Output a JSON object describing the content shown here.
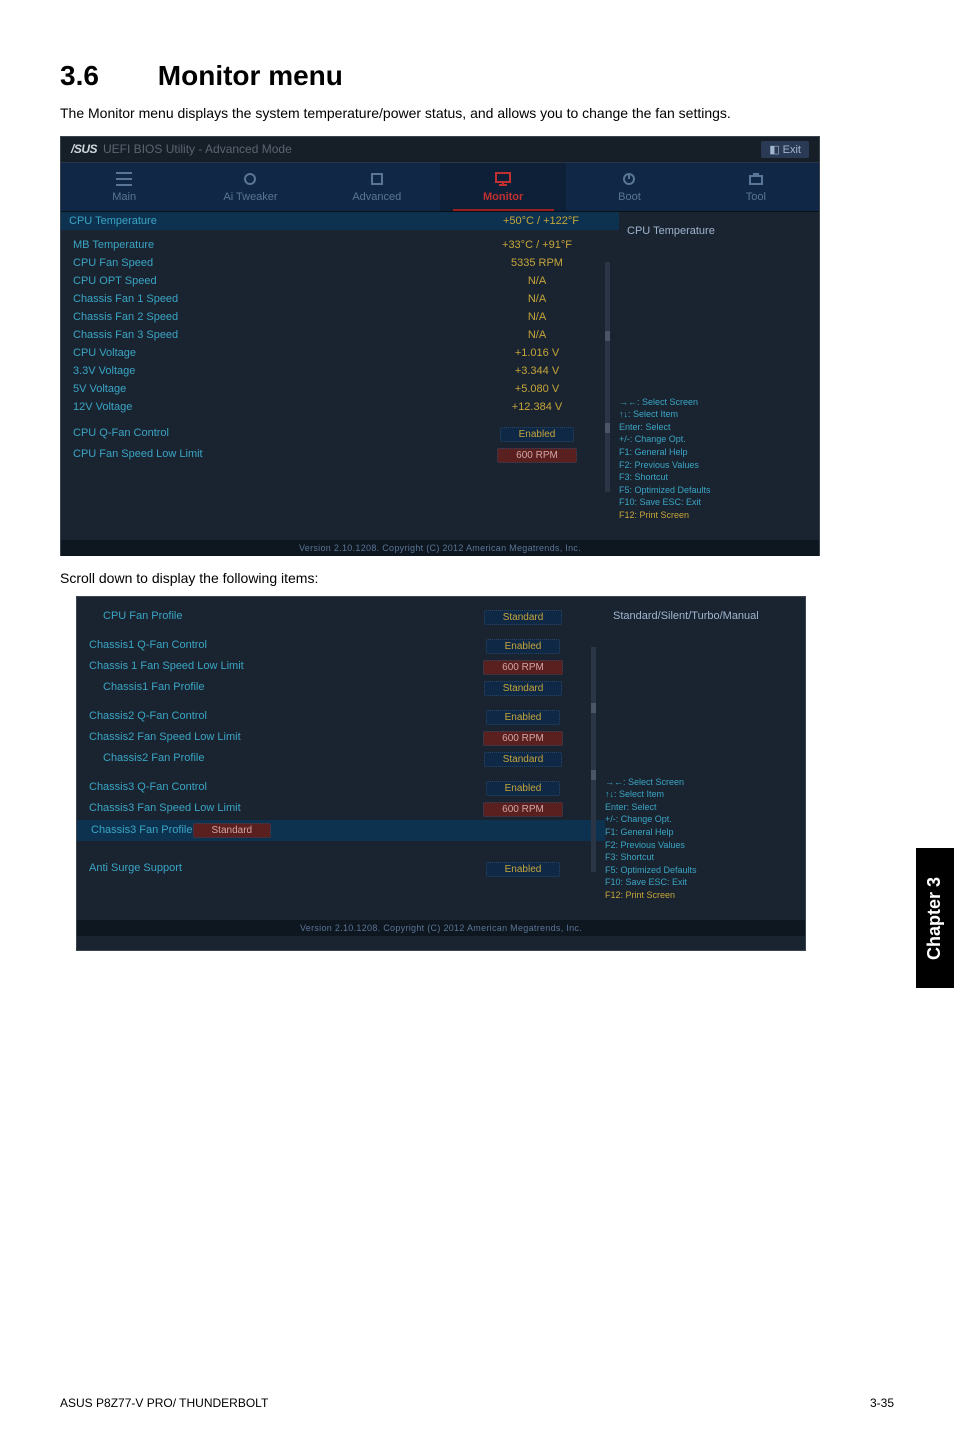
{
  "heading": {
    "num": "3.6",
    "title": "Monitor menu"
  },
  "intro": "The Monitor menu displays the system temperature/power status, and allows you to change the fan settings.",
  "midtext": "Scroll down to display the following items:",
  "bios_title": {
    "logo": "/SUS",
    "rest": "UEFI BIOS Utility - Advanced Mode",
    "exit": "Exit"
  },
  "tabs": [
    "Main",
    "Ai Tweaker",
    "Advanced",
    "Monitor",
    "Boot",
    "Tool"
  ],
  "bios1": {
    "subheader": "CPU Temperature",
    "right_header": "CPU Temperature",
    "rows": [
      {
        "lbl": "MB Temperature",
        "val": "+33°C / +91°F",
        "cls": "yellow"
      },
      {
        "lbl": "CPU Fan Speed",
        "val": "5335 RPM",
        "cls": "yellow"
      },
      {
        "lbl": "CPU OPT Speed",
        "val": "N/A",
        "cls": "yellow"
      },
      {
        "lbl": "Chassis Fan 1 Speed",
        "val": "N/A",
        "cls": "yellow"
      },
      {
        "lbl": "Chassis Fan 2 Speed",
        "val": "N/A",
        "cls": "yellow"
      },
      {
        "lbl": "Chassis Fan 3 Speed",
        "val": "N/A",
        "cls": "yellow"
      },
      {
        "lbl": "CPU Voltage",
        "val": "+1.016 V",
        "cls": "yellow"
      },
      {
        "lbl": "3.3V Voltage",
        "val": "+3.344 V",
        "cls": "yellow"
      },
      {
        "lbl": "5V Voltage",
        "val": "+5.080 V",
        "cls": "yellow"
      },
      {
        "lbl": "12V Voltage",
        "val": "+12.384 V",
        "cls": "yellow"
      }
    ],
    "sub_val": "+50°C / +122°F",
    "qfan": {
      "lbl": "CPU Q-Fan Control",
      "val": "Enabled"
    },
    "lowlimit": {
      "lbl": "CPU Fan Speed Low Limit",
      "val": "600 RPM"
    }
  },
  "bios2": {
    "profile": {
      "lbl": "CPU Fan Profile",
      "val": "Standard",
      "right": "Standard/Silent/Turbo/Manual"
    },
    "groups": [
      {
        "a": {
          "lbl": "Chassis1 Q-Fan Control",
          "val": "Enabled"
        },
        "b": {
          "lbl": "Chassis 1 Fan Speed Low Limit",
          "val": "600 RPM"
        },
        "c": {
          "lbl": "Chassis1 Fan Profile",
          "val": "Standard"
        }
      },
      {
        "a": {
          "lbl": "Chassis2 Q-Fan Control",
          "val": "Enabled"
        },
        "b": {
          "lbl": "Chassis2 Fan Speed Low Limit",
          "val": "600 RPM"
        },
        "c": {
          "lbl": "Chassis2 Fan Profile",
          "val": "Standard"
        }
      },
      {
        "a": {
          "lbl": "Chassis3 Q-Fan Control",
          "val": "Enabled"
        },
        "b": {
          "lbl": "Chassis3 Fan Speed Low Limit",
          "val": "600 RPM"
        },
        "c": {
          "lbl": "Chassis3 Fan Profile",
          "val": "Standard",
          "hl": true
        }
      }
    ],
    "surge": {
      "lbl": "Anti Surge Support",
      "val": "Enabled"
    }
  },
  "help": [
    {
      "k": "→←",
      "t": ": Select Screen"
    },
    {
      "k": "↑↓",
      "t": ": Select Item"
    },
    {
      "k": "Enter",
      "t": ": Select"
    },
    {
      "k": "+/-",
      "t": ": Change Opt."
    },
    {
      "k": "F1",
      "t": ": General Help"
    },
    {
      "k": "F2",
      "t": ": Previous Values"
    },
    {
      "k": "F3",
      "t": ": Shortcut"
    },
    {
      "k": "F5",
      "t": ": Optimized Defaults"
    },
    {
      "k": "F10",
      "t": ": Save   ESC: Exit"
    },
    {
      "k": "F12",
      "t": ": Print Screen",
      "y": true
    }
  ],
  "copyright": "Version 2.10.1208. Copyright (C) 2012 American Megatrends, Inc.",
  "chapter": "Chapter 3",
  "footer": {
    "left": "ASUS P8Z77-V PRO/ THUNDERBOLT",
    "right": "3-35"
  }
}
